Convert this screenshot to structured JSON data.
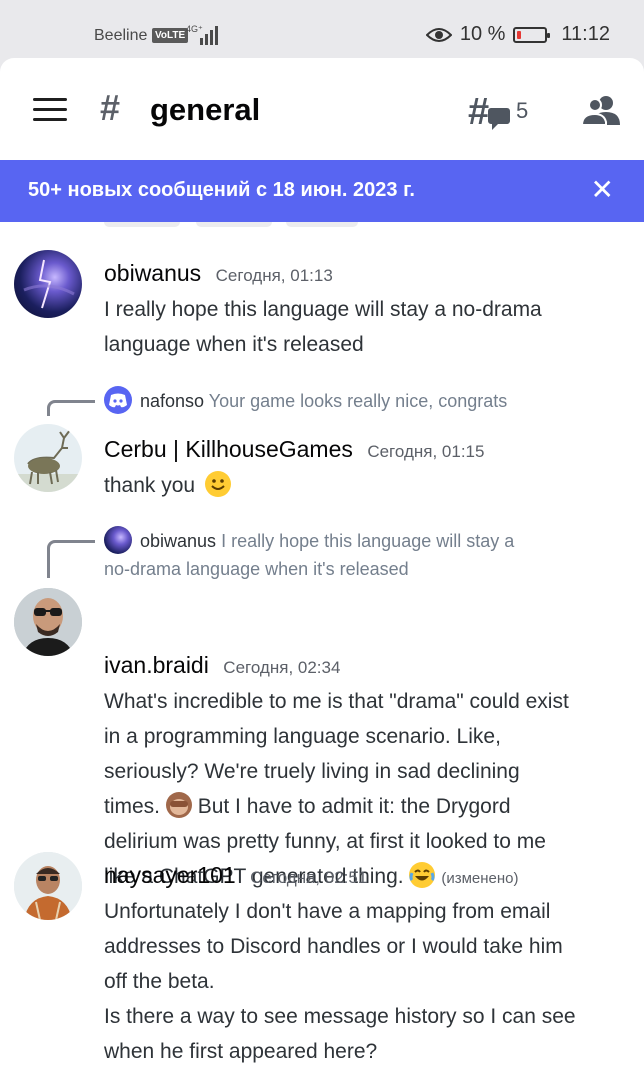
{
  "status_bar": {
    "carrier": "Beeline",
    "volte": "VoLTE",
    "network": "4G⁺",
    "eye_percent": "10 %",
    "time": "11:12"
  },
  "header": {
    "channel_name": "general",
    "threads_count": "5"
  },
  "banner": {
    "text": "50+ новых сообщений с 18 июн. 2023 г.",
    "close": "✕"
  },
  "messages": [
    {
      "author": "obiwanus",
      "timestamp": "Сегодня, 01:13",
      "lines": [
        "I really hope this language will stay a no-drama",
        "language when it's released"
      ]
    },
    {
      "reply_author": "nafonso",
      "reply_text": "Your game looks really nice, congrats",
      "author": "Cerbu | KillhouseGames",
      "timestamp": "Сегодня, 01:15",
      "lines": [
        "thank you"
      ]
    },
    {
      "reply_author": "obiwanus",
      "reply_text": "I really hope this language will stay a",
      "reply_text2": "no-drama language when it's released",
      "author": "ivan.braidi",
      "timestamp": "Сегодня, 02:34",
      "lines": [
        "What's incredible to me is that \"drama\" could exist",
        "in a programming language scenario. Like,",
        "seriously? We're truely living in sad declining",
        "times.",
        "But I have to admit it: the Drygord",
        "delirium was pretty funny, at first it looked to me",
        "like a ChatGPT generated thing."
      ],
      "edited": "(изменено)"
    },
    {
      "author": "naysayer101",
      "timestamp": "Сегодня, 02:51",
      "lines": [
        "Unfortunately I don't have a mapping from email",
        "addresses to Discord handles or I would take him",
        "off the beta.",
        "Is there a way to see message history so I can see",
        "when he first appeared here?"
      ]
    }
  ],
  "colors": {
    "blurple": "#5865f2",
    "text": "#2e3338",
    "muted": "#5c6068"
  }
}
